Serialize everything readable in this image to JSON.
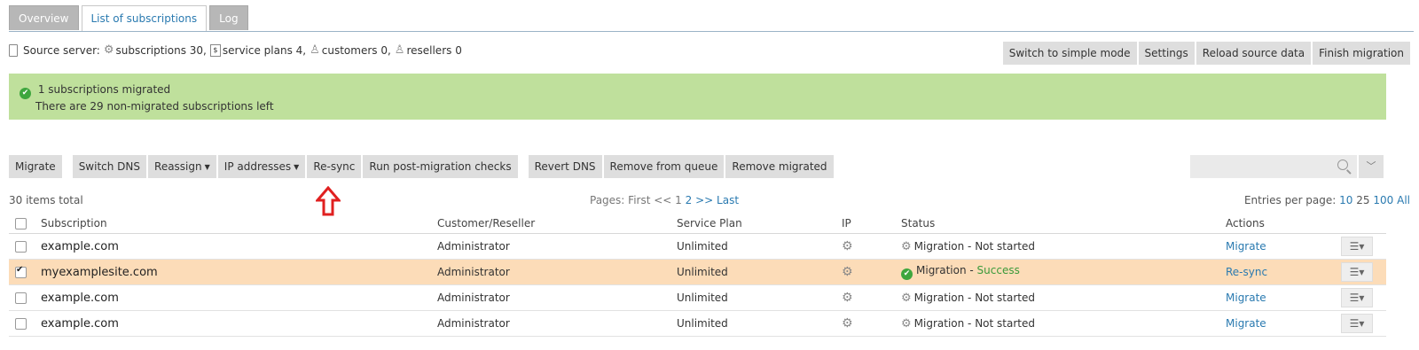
{
  "tabs": [
    "Overview",
    "List of subscriptions",
    "Log"
  ],
  "source": {
    "label": "Source server:",
    "subscriptions": "subscriptions 30,",
    "service_plans": "service plans 4,",
    "customers": "customers 0,",
    "resellers": "resellers 0"
  },
  "top_buttons": [
    "Switch to simple mode",
    "Settings",
    "Reload source data",
    "Finish migration"
  ],
  "banner": {
    "line1": "1 subscriptions migrated",
    "line2": "There are 29 non-migrated subscriptions left",
    "color": "#bfe09c"
  },
  "toolbar": {
    "migrate": "Migrate",
    "switch_dns": "Switch DNS",
    "reassign": "Reassign",
    "ip_addresses": "IP addresses",
    "resync": "Re-sync",
    "post_checks": "Run post-migration checks",
    "revert_dns": "Revert DNS",
    "remove_queue": "Remove from queue",
    "remove_migrated": "Remove migrated"
  },
  "search": {
    "placeholder": ""
  },
  "meta": {
    "total": "30 items total",
    "pages_label": "Pages: First <<",
    "page1": "1",
    "page2": "2",
    "next": ">>",
    "last": "Last",
    "epp_label": "Entries per page:",
    "epp10": "10",
    "epp25": "25",
    "epp100": "100",
    "eppall": "All"
  },
  "table": {
    "headers": {
      "subscription": "Subscription",
      "customer": "Customer/Reseller",
      "plan": "Service Plan",
      "ip": "IP",
      "status": "Status",
      "actions": "Actions"
    },
    "rows": [
      {
        "subscription": "example.com",
        "customer": "Administrator",
        "plan": "Unlimited",
        "status_prefix": "Migration - ",
        "status": "Not started",
        "action": "Migrate"
      },
      {
        "subscription": "myexamplesite.com",
        "customer": "Administrator",
        "plan": "Unlimited",
        "status_prefix": "Migration - ",
        "status": "Success",
        "action": "Re-sync"
      },
      {
        "subscription": "example.com",
        "customer": "Administrator",
        "plan": "Unlimited",
        "status_prefix": "Migration - ",
        "status": "Not started",
        "action": "Migrate"
      },
      {
        "subscription": "example.com",
        "customer": "Administrator",
        "plan": "Unlimited",
        "status_prefix": "Migration - ",
        "status": "Not started",
        "action": "Migrate"
      }
    ]
  },
  "colors": {
    "accent": "#2a7ab0",
    "selected_row": "#fcdcb8",
    "arrow": "#e02020",
    "success": "#3a9a3a"
  }
}
